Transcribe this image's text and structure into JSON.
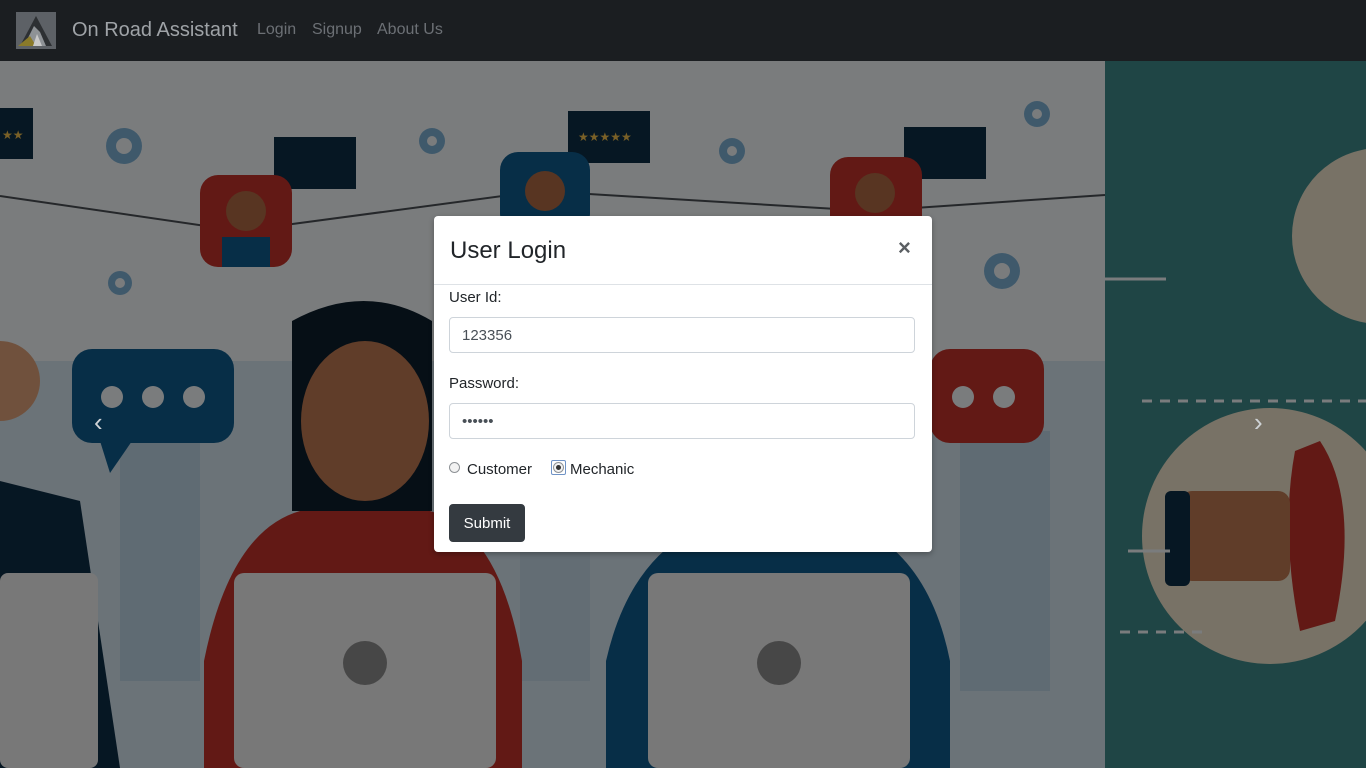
{
  "navbar": {
    "brand": "On Road Assistant",
    "links": [
      "Login",
      "Signup",
      "About Us"
    ]
  },
  "modal": {
    "title": "User Login",
    "close_glyph": "×",
    "user_id_label": "User Id:",
    "user_id_value": "123356",
    "password_label": "Password:",
    "password_value": "••••••",
    "role_options": [
      "Customer",
      "Mechanic"
    ],
    "selected_role": "Mechanic",
    "submit_label": "Submit"
  },
  "carousel": {
    "prev_glyph": "‹",
    "next_glyph": "›"
  },
  "hero_speech_bubble_ratings": {
    "left": "★★",
    "center": "★★★★★"
  },
  "colors": {
    "navbar_bg": "#1b1e21",
    "submit_bg": "#343a40",
    "accent_red": "#c4332a",
    "accent_blue": "#0f5d8f",
    "teal_panel": "#3f8a8a"
  }
}
